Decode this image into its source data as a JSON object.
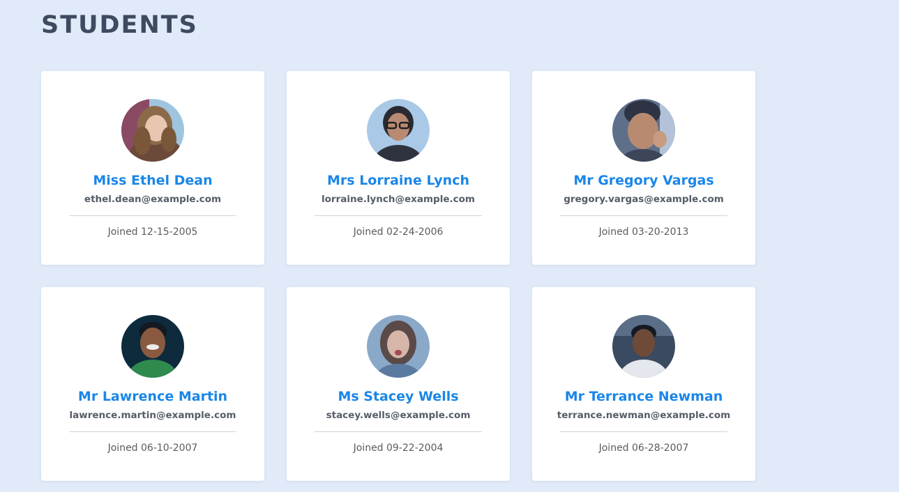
{
  "page": {
    "title": "STUDENTS"
  },
  "colors": {
    "background": "#e1eaf8",
    "title": "#3d4a5f",
    "name": "#1a86e8",
    "email": "#555c68",
    "joined": "#5b5b5b",
    "card": "#ffffff"
  },
  "students": [
    {
      "name": "Miss Ethel Dean",
      "email": "ethel.dean@example.com",
      "joined": "Joined 12-15-2005",
      "avatar_icon": "avatar-photo-woman-curly-hair"
    },
    {
      "name": "Mrs Lorraine Lynch",
      "email": "lorraine.lynch@example.com",
      "joined": "Joined 02-24-2006",
      "avatar_icon": "avatar-photo-woman-glasses"
    },
    {
      "name": "Mr Gregory Vargas",
      "email": "gregory.vargas@example.com",
      "joined": "Joined 03-20-2013",
      "avatar_icon": "avatar-photo-man-smiling"
    },
    {
      "name": "Mr Lawrence Martin",
      "email": "lawrence.martin@example.com",
      "joined": "Joined 06-10-2007",
      "avatar_icon": "avatar-photo-man-green-shirt"
    },
    {
      "name": "Ms Stacey Wells",
      "email": "stacey.wells@example.com",
      "joined": "Joined 09-22-2004",
      "avatar_icon": "avatar-photo-woman-surprised"
    },
    {
      "name": "Mr Terrance Newman",
      "email": "terrance.newman@example.com",
      "joined": "Joined 06-28-2007",
      "avatar_icon": "avatar-photo-man-white-shirt"
    }
  ]
}
